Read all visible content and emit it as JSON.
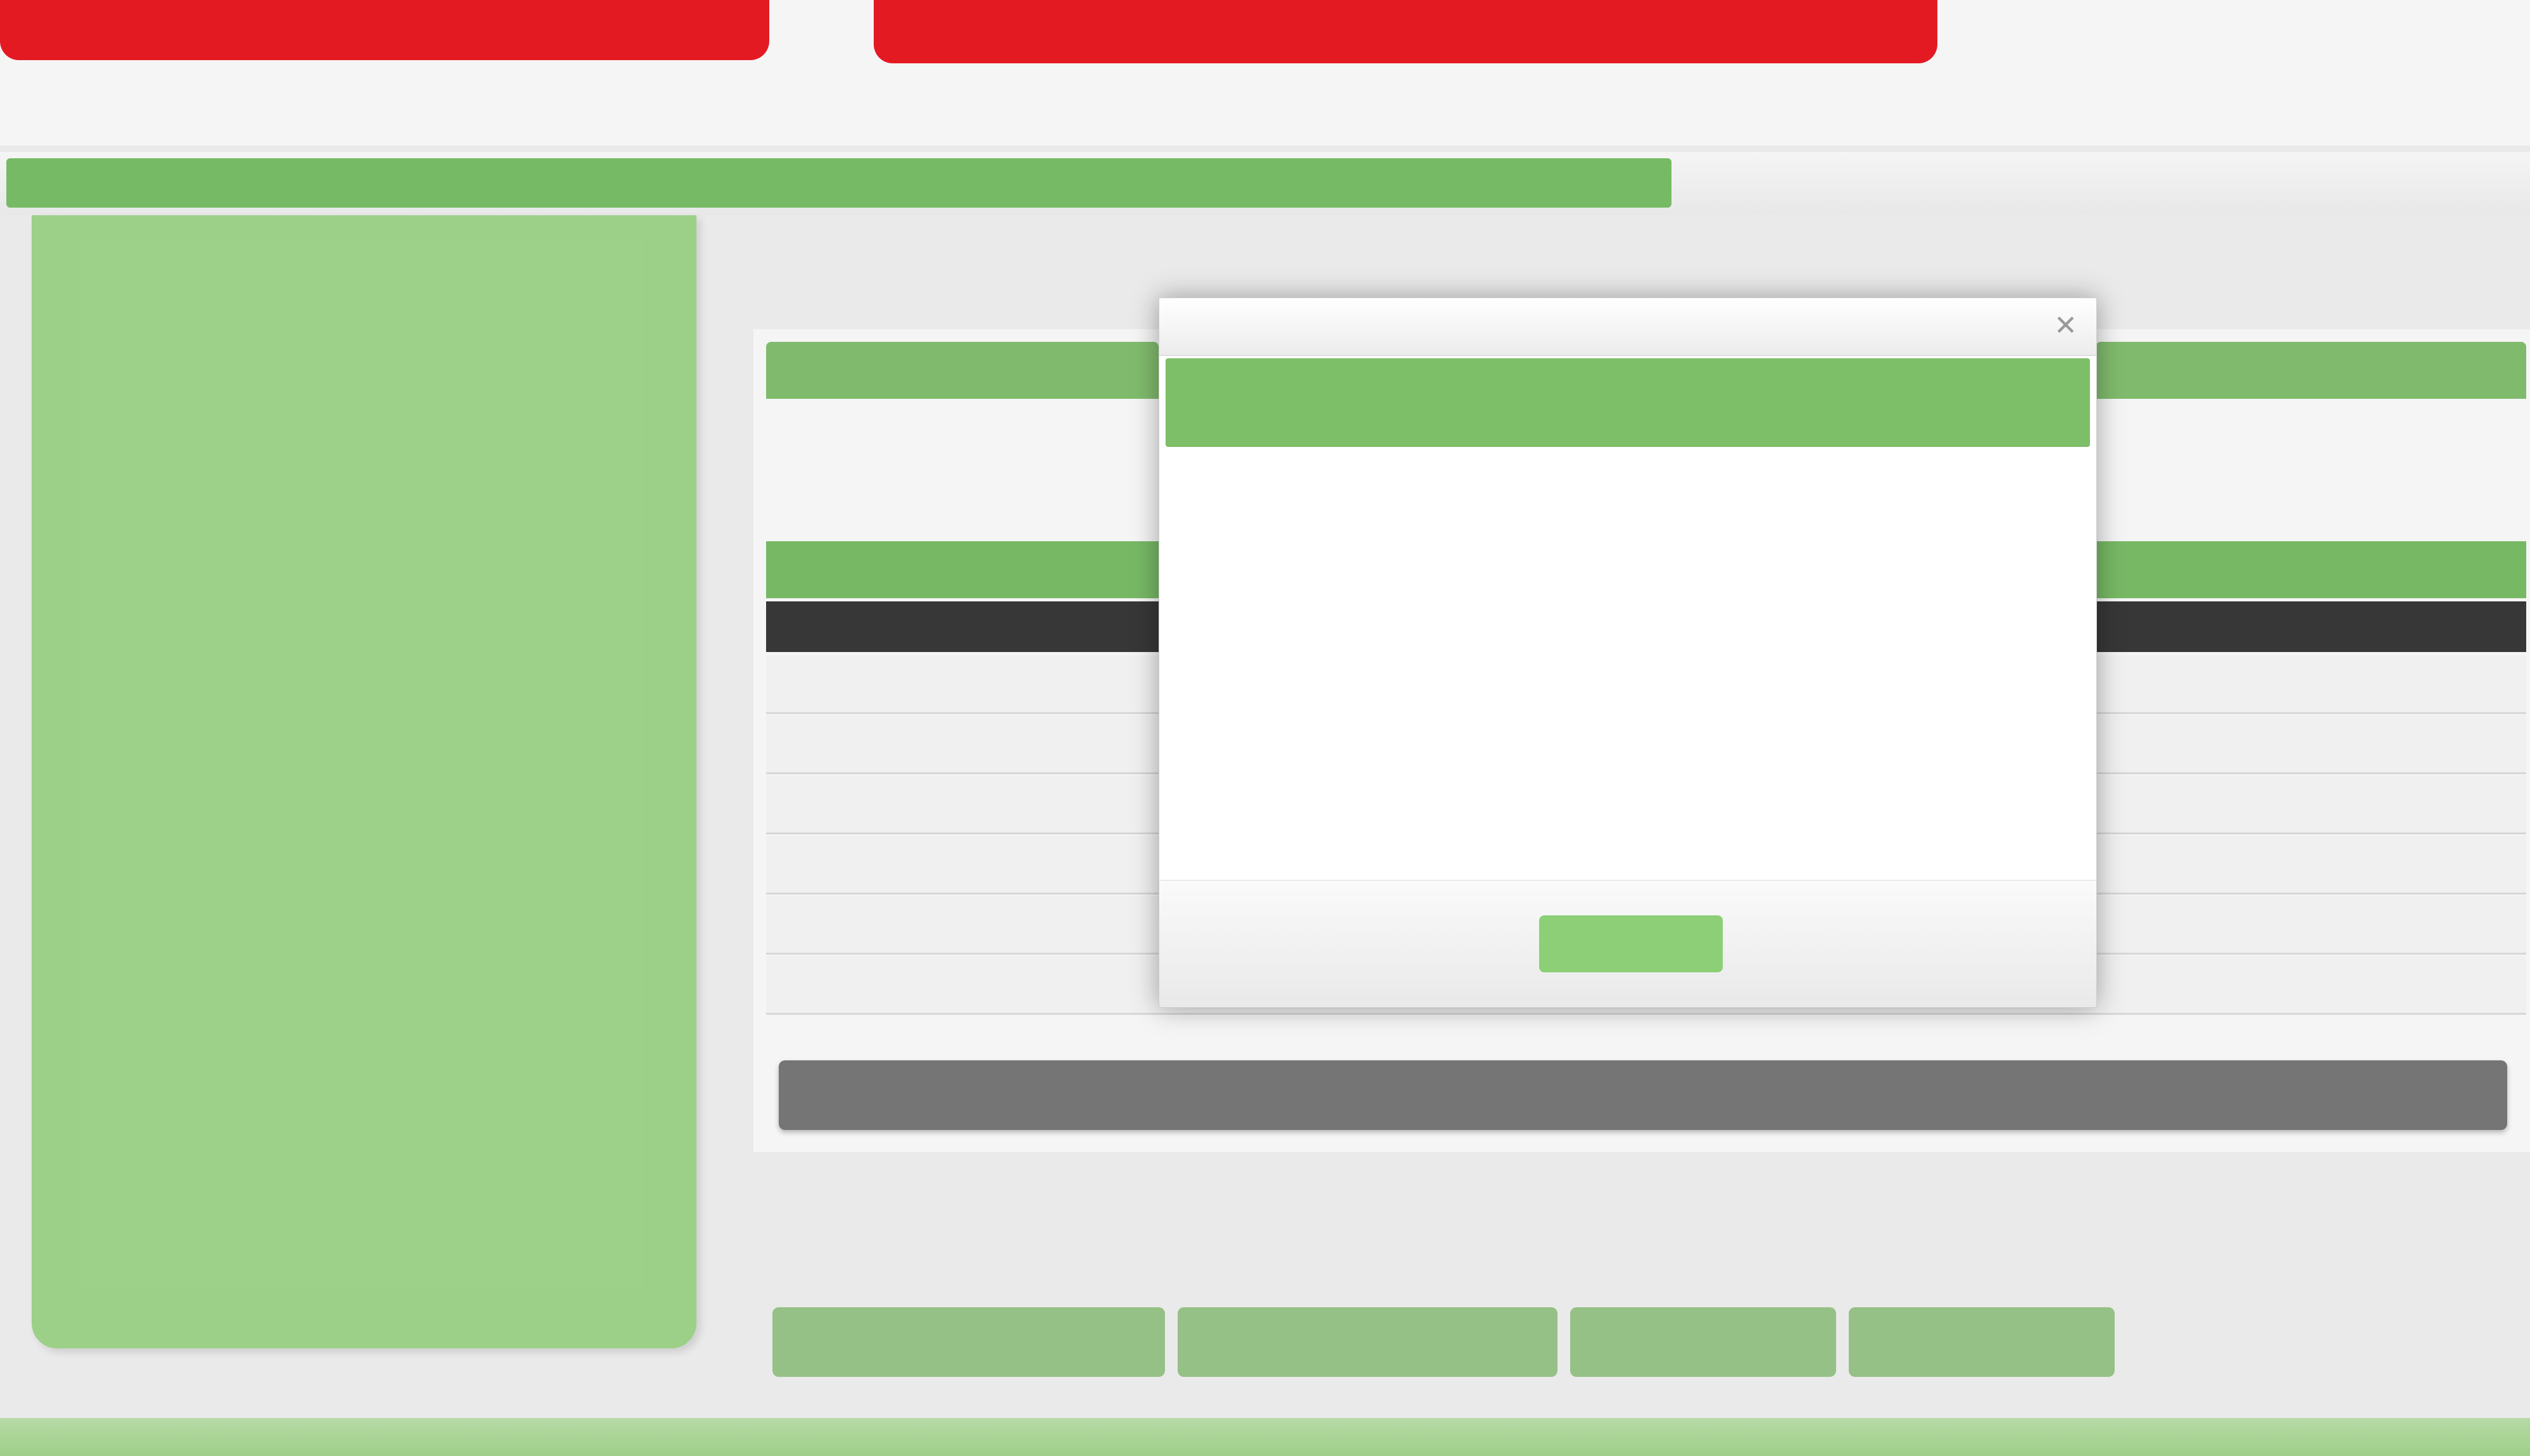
{
  "header": {
    "logo": "",
    "user_lines": [
      "",
      "",
      ""
    ],
    "links": [
      "",
      "",
      ""
    ]
  },
  "breadcrumb": {
    "text": "",
    "tail": ""
  },
  "sidebar": {
    "items": [
      {
        "label": ""
      },
      {
        "label": ""
      },
      {
        "label": ""
      },
      {
        "label": ""
      },
      {
        "label": ""
      },
      {
        "label": ""
      },
      {
        "label": ""
      },
      {
        "label": ""
      },
      {
        "label": ""
      },
      {
        "label": ""
      },
      {
        "label": ""
      },
      {
        "label": ""
      },
      {
        "label": ""
      },
      {
        "label": ""
      },
      {
        "label": ""
      },
      {
        "label": ""
      },
      {
        "label": ""
      },
      {
        "label": ""
      },
      {
        "label": ""
      },
      {
        "label": ""
      },
      {
        "label": ""
      },
      {
        "label": ""
      },
      {
        "label": ""
      },
      {
        "label": ""
      },
      {
        "label": ""
      },
      {
        "label": ""
      },
      {
        "label": ""
      },
      {
        "label": ""
      },
      {
        "label": ""
      },
      {
        "label": ""
      },
      {
        "label": ""
      },
      {
        "label": ""
      },
      {
        "label": ""
      }
    ]
  },
  "main": {
    "title": "",
    "info_line": "",
    "info_highlight": "",
    "grid_headers": [
      "",
      "",
      "",
      ""
    ],
    "pager": {
      "buttons": [
        "",
        ""
      ],
      "info": ""
    }
  },
  "actions": [
    "",
    "",
    "",
    "",
    "",
    ""
  ],
  "footer": {
    "text": ""
  },
  "modal": {
    "title": "",
    "header": "",
    "message_1": "",
    "message_2": "",
    "ok_label": ""
  },
  "colors": {
    "brand_red": "#ee1c25",
    "sidebar_green": "#a3d98f",
    "accent_green": "#7dbe68",
    "pager_gray": "#7a7a7a"
  }
}
